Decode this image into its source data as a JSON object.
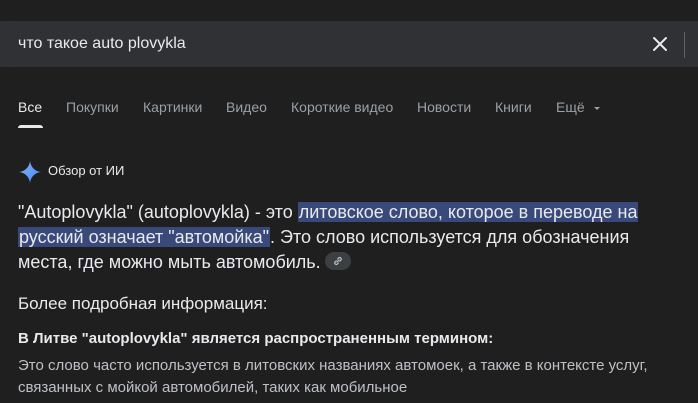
{
  "search": {
    "query": "что такое auto plovykla"
  },
  "tabs": [
    {
      "label": "Все",
      "active": true
    },
    {
      "label": "Покупки"
    },
    {
      "label": "Картинки"
    },
    {
      "label": "Видео"
    },
    {
      "label": "Короткие видео"
    },
    {
      "label": "Новости"
    },
    {
      "label": "Книги"
    },
    {
      "label": "Ещё"
    }
  ],
  "ai_overview": {
    "title": "Обзор от ИИ",
    "answer_part1": "\"Autoplovykla\" (autoplovykla) - это ",
    "answer_highlight_1": "литовское слово, которое в переводе на",
    "answer_highlight_2": "русский означает \"автомойка\"",
    "answer_part2": ". Это слово используется для обозначения места, где можно мыть автомобиль.",
    "more_info": "Более подробная информация:",
    "section_heading": "В Литве \"autoplovykla\" является распространенным термином:",
    "section_text": "Это слово часто используется в литовских названиях автомоек, а также в контексте услуг, связанных с мойкой автомобилей, таких как мобильное"
  },
  "colors": {
    "background": "#1f1f1f",
    "search_bg": "#303134",
    "highlight": "#394a7a",
    "ai_accent": "#8ab4f8"
  }
}
